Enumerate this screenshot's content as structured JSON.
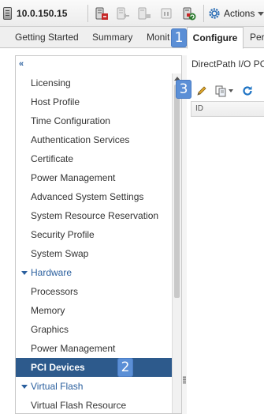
{
  "toolbar": {
    "host_name": "10.0.150.15",
    "actions_label": "Actions",
    "icons": [
      "host-icon",
      "enter-maintenance-icon",
      "exit-maintenance-icon",
      "power-off-icon",
      "suspend-icon",
      "refresh-host-icon",
      "actions-gear-icon"
    ]
  },
  "tabs": [
    {
      "label": "Getting Started"
    },
    {
      "label": "Summary"
    },
    {
      "label": "Monit"
    },
    {
      "label": "Configure",
      "active": true
    },
    {
      "label": "Per"
    }
  ],
  "sidebar": {
    "items": [
      {
        "label": "Licensing"
      },
      {
        "label": "Host Profile"
      },
      {
        "label": "Time Configuration"
      },
      {
        "label": "Authentication Services"
      },
      {
        "label": "Certificate"
      },
      {
        "label": "Power Management"
      },
      {
        "label": "Advanced System Settings"
      },
      {
        "label": "System Resource Reservation"
      },
      {
        "label": "Security Profile"
      },
      {
        "label": "System Swap"
      },
      {
        "label": "Hardware",
        "group": true
      },
      {
        "label": "Processors"
      },
      {
        "label": "Memory"
      },
      {
        "label": "Graphics"
      },
      {
        "label": "Power Management"
      },
      {
        "label": "PCI Devices",
        "selected": true
      },
      {
        "label": "Virtual Flash",
        "group": true
      },
      {
        "label": "Virtual Flash Resource"
      }
    ]
  },
  "content": {
    "title": "DirectPath I/O PC",
    "columns": [
      "ID"
    ]
  },
  "callouts": [
    "1",
    "2",
    "3"
  ],
  "colors": {
    "selected_bg": "#2d5a8c",
    "group_text": "#2a5f9e",
    "callout": "#5b8fd6"
  }
}
